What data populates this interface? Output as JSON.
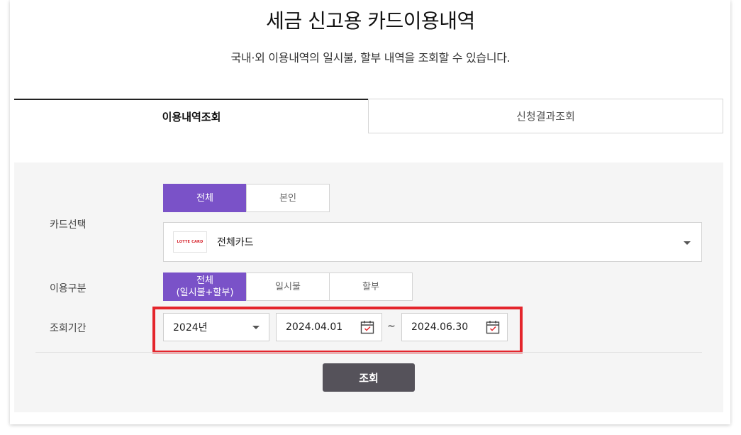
{
  "header": {
    "title": "세금 신고용 카드이용내역",
    "subtitle": "국내·외 이용내역의 일시불, 할부 내역을 조회할 수 있습니다."
  },
  "tabs": [
    {
      "label": "이용내역조회",
      "active": true
    },
    {
      "label": "신청결과조회",
      "active": false
    }
  ],
  "form": {
    "card_selection": {
      "label": "카드선택",
      "options": [
        {
          "label": "전체",
          "selected": true
        },
        {
          "label": "본인",
          "selected": false
        }
      ],
      "dropdown": {
        "logo_text": "LOTTE CARD",
        "value": "전체카드",
        "icon": "chevron-down-icon"
      }
    },
    "usage_type": {
      "label": "이용구분",
      "options": [
        {
          "label_line1": "전체",
          "label_line2": "(일시불+할부)",
          "selected": true
        },
        {
          "label": "일시불",
          "selected": false
        },
        {
          "label": "할부",
          "selected": false
        }
      ]
    },
    "period": {
      "label": "조회기간",
      "year": "2024년",
      "start_date": "2024.04.01",
      "separator": "~",
      "end_date": "2024.06.30",
      "icon": "calendar-icon"
    },
    "search_button": "조회"
  },
  "colors": {
    "accent": "#7a52c8",
    "button": "#55525a",
    "highlight": "#e4252c",
    "panel_bg": "#f5f5f5"
  }
}
